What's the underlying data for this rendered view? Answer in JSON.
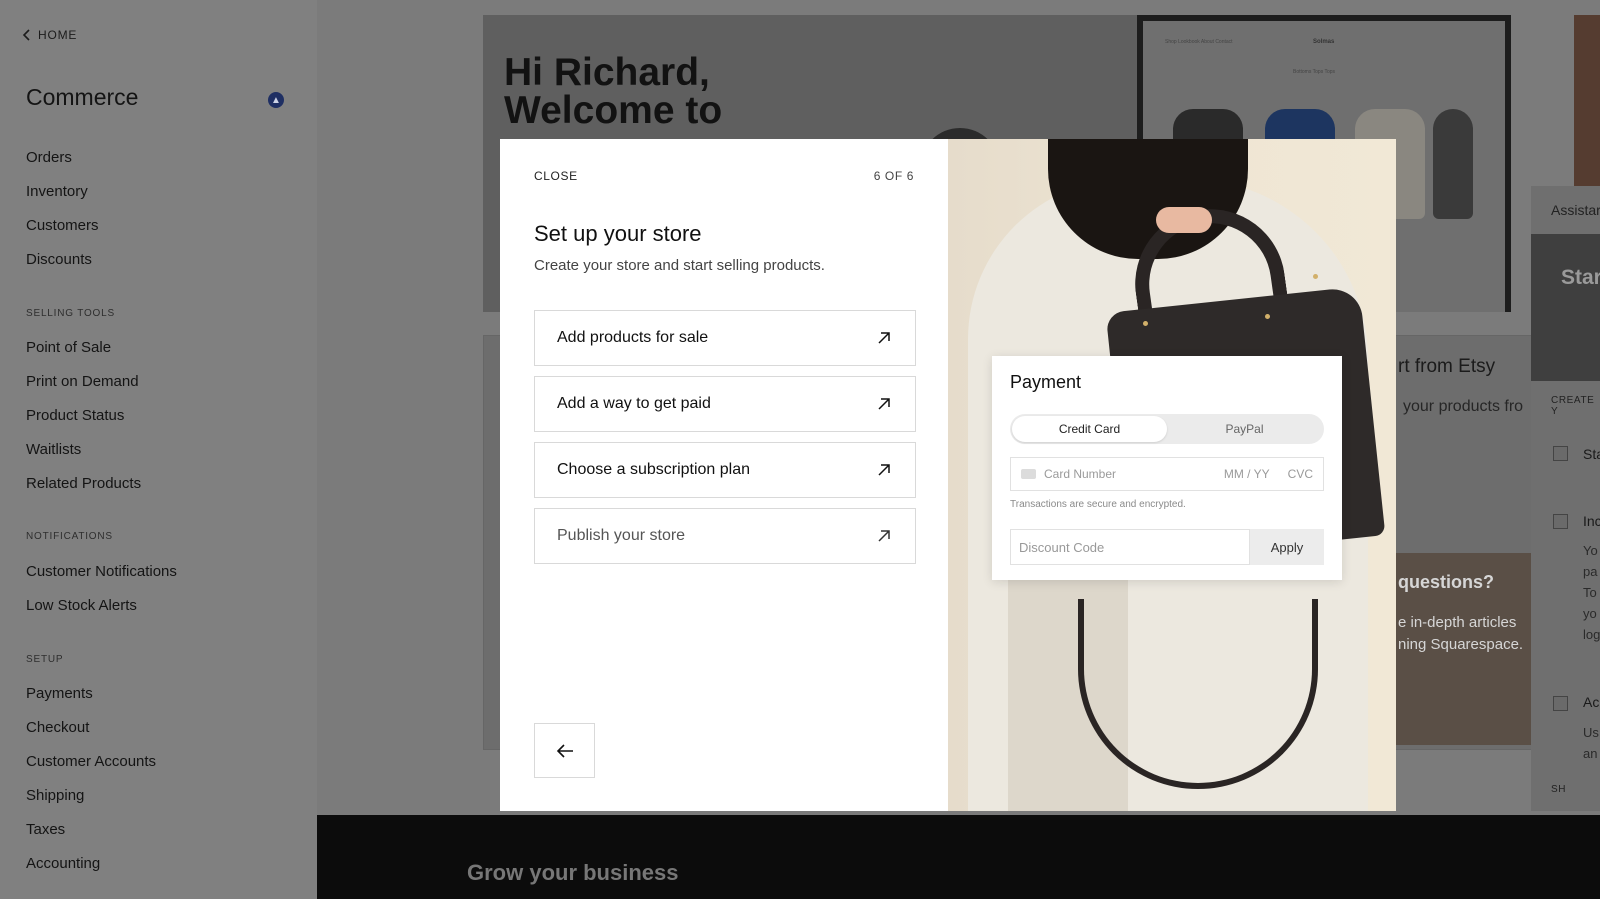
{
  "sidebar": {
    "home_label": "HOME",
    "title": "Commerce",
    "groups": {
      "main": [
        "Orders",
        "Inventory",
        "Customers",
        "Discounts"
      ],
      "selling_tools_header": "SELLING TOOLS",
      "selling_tools": [
        "Point of Sale",
        "Print on Demand",
        "Product Status",
        "Waitlists",
        "Related Products"
      ],
      "notifications_header": "NOTIFICATIONS",
      "notifications": [
        "Customer Notifications",
        "Low Stock Alerts"
      ],
      "setup_header": "SETUP",
      "setup": [
        "Payments",
        "Checkout",
        "Customer Accounts",
        "Shipping",
        "Taxes",
        "Accounting"
      ]
    }
  },
  "background": {
    "hero_line1": "Hi Richard,",
    "hero_line2": "Welcome to",
    "laptop_nav": "Shop   Lookbook   About   Contact",
    "laptop_brand": "Solmas",
    "laptop_sub": "Bottoms    Tops    Tops",
    "etsy_title": "rt from Etsy",
    "etsy_sub": "your products fro",
    "questions_title": "questions?",
    "questions_line1": "e in-depth articles",
    "questions_line2": "ning Squarespace.",
    "grow_title": "Grow your business"
  },
  "assistant": {
    "title": "Assistar",
    "banner": "Star",
    "create": "CREATE Y",
    "item1": "Sta",
    "item2": "Inc",
    "item2_lines": [
      "Yo",
      "pa",
      "To",
      "yo",
      "log"
    ],
    "item3": "Ac",
    "item3_lines": [
      "Us",
      "an"
    ],
    "show": "SH"
  },
  "modal": {
    "close_label": "CLOSE",
    "step_counter": "6 OF 6",
    "title": "Set up your store",
    "subtitle": "Create your store and start selling products.",
    "steps": [
      {
        "label": "Add products for sale"
      },
      {
        "label": "Add a way to get paid"
      },
      {
        "label": "Choose a subscription plan"
      },
      {
        "label": "Publish your store"
      }
    ]
  },
  "payment": {
    "title": "Payment",
    "options": [
      "Credit Card",
      "PayPal"
    ],
    "selected": "Credit Card",
    "card_placeholder": "Card Number",
    "expiry_placeholder": "MM / YY",
    "cvc_placeholder": "CVC",
    "secure_note": "Transactions are secure and encrypted.",
    "discount_placeholder": "Discount Code",
    "apply_label": "Apply"
  },
  "colors": {
    "overlay": "#7b7b7b",
    "modal_bg": "#ffffff",
    "photo_bg": "#e9dfcc",
    "grow_band": "#0c0c0c"
  }
}
